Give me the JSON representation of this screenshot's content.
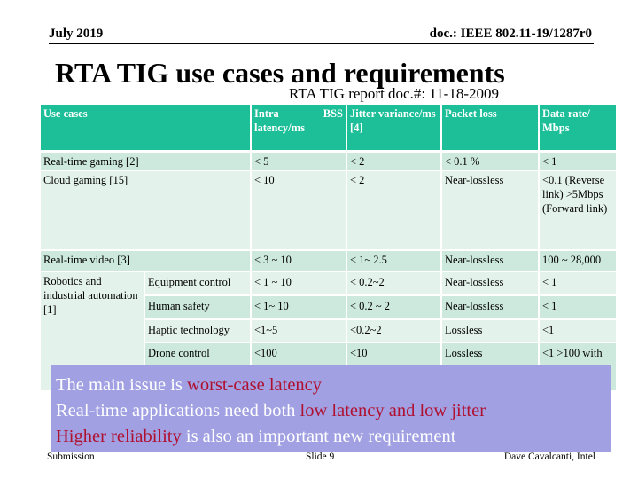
{
  "header": {
    "date": "July 2019",
    "doc": "doc.: IEEE 802.11-19/1287r0"
  },
  "title": "RTA TIG use cases and requirements",
  "subtitle": "RTA TIG report doc.#: 11-18-2009",
  "table": {
    "columns": [
      "Use cases",
      "Intra BSS latency/ms",
      "Jitter variance/ms [4]",
      "Packet loss",
      "Data rate/ Mbps"
    ],
    "rows": [
      {
        "use_case": "Real-time gaming [2]",
        "latency": "< 5",
        "jitter": "< 2",
        "loss": "< 0.1 %",
        "rate": "< 1"
      },
      {
        "use_case": "Cloud gaming [15]",
        "latency": "< 10",
        "jitter": "< 2",
        "loss": "Near-lossless",
        "rate": "<0.1 (Reverse link) >5Mbps (Forward link)"
      },
      {
        "use_case": "Real-time video [3]",
        "latency": "< 3 ~ 10",
        "jitter": "< 1~ 2.5",
        "loss": "Near-lossless",
        "rate": "100 ~ 28,000"
      }
    ],
    "robotics": {
      "group": "Robotics and industrial automation [1]",
      "rows": [
        {
          "use_case": "Equipment control",
          "latency": "< 1 ~ 10",
          "jitter": "< 0.2~2",
          "loss": "Near-lossless",
          "rate": "< 1"
        },
        {
          "use_case": "Human safety",
          "latency": "< 1~ 10",
          "jitter": "< 0.2 ~ 2",
          "loss": "Near-lossless",
          "rate": "< 1"
        },
        {
          "use_case": "Haptic technology",
          "latency": "<1~5",
          "jitter": "<0.2~2",
          "loss": "Lossless",
          "rate": "<1"
        },
        {
          "use_case": "Drone control",
          "latency": "<100",
          "jitter": "<10",
          "loss": "Lossless",
          "rate": "<1 >100 with"
        }
      ]
    }
  },
  "overlay": {
    "line1": {
      "a": "The main issue is ",
      "b": "worst-case latency"
    },
    "line2": {
      "a": "Real-time applications need both ",
      "b": "low latency and low jitter"
    },
    "line3": {
      "a": "Higher reliability",
      "b": " is also an important new requirement"
    },
    "colors": {
      "background": "#a0a0e2",
      "highlight": "#b01030",
      "header": "#1dbf99"
    }
  },
  "footer": {
    "left": "Submission",
    "center": "Slide 9",
    "right": "Dave Cavalcanti, Intel"
  }
}
